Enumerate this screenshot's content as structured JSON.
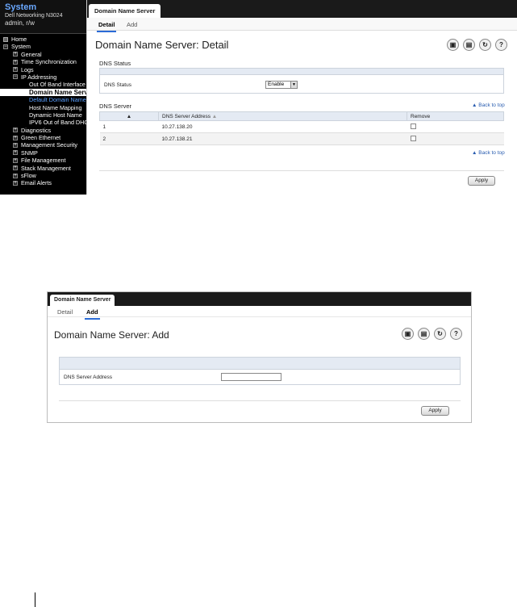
{
  "shot1": {
    "sidebar": {
      "system_title": "System",
      "model": "Dell Networking N3024",
      "user": "admin, r/w",
      "tree": [
        {
          "label": "Home",
          "indent": 0,
          "kind": "plain"
        },
        {
          "label": "System",
          "indent": 0,
          "kind": "collapse"
        },
        {
          "label": "General",
          "indent": 1,
          "kind": "expand"
        },
        {
          "label": "Time Synchronization",
          "indent": 1,
          "kind": "expand"
        },
        {
          "label": "Logs",
          "indent": 1,
          "kind": "expand"
        },
        {
          "label": "IP Addressing",
          "indent": 1,
          "kind": "collapse"
        },
        {
          "label": "Out Of Band Interface",
          "indent": 2,
          "kind": "leaf"
        },
        {
          "label": "Domain Name Server",
          "indent": 2,
          "kind": "selected"
        },
        {
          "label": "Default Domain Name",
          "indent": 2,
          "kind": "sub"
        },
        {
          "label": "Host Name Mapping",
          "indent": 2,
          "kind": "leaf"
        },
        {
          "label": "Dynamic Host Name",
          "indent": 2,
          "kind": "leaf"
        },
        {
          "label": "IPV6 Out of Band DHCP",
          "indent": 2,
          "kind": "leaf"
        },
        {
          "label": "Diagnostics",
          "indent": 1,
          "kind": "expand"
        },
        {
          "label": "Green Ethernet",
          "indent": 1,
          "kind": "expand"
        },
        {
          "label": "Management Security",
          "indent": 1,
          "kind": "expand"
        },
        {
          "label": "SNMP",
          "indent": 1,
          "kind": "expand"
        },
        {
          "label": "File Management",
          "indent": 1,
          "kind": "expand"
        },
        {
          "label": "Stack Management",
          "indent": 1,
          "kind": "expand"
        },
        {
          "label": "sFlow",
          "indent": 1,
          "kind": "expand"
        },
        {
          "label": "Email Alerts",
          "indent": 1,
          "kind": "expand"
        }
      ]
    },
    "tab": "Domain Name Server",
    "subtabs": {
      "detail": "Detail",
      "add": "Add"
    },
    "title": "Domain Name Server: Detail",
    "icons": [
      "save-icon",
      "print-icon",
      "refresh-icon",
      "help-icon"
    ],
    "dns_status": {
      "section": "DNS Status",
      "label": "DNS Status",
      "value": "Enable"
    },
    "dns_server": {
      "section": "DNS Server",
      "back_to_top": "Back to top",
      "columns": [
        "",
        "DNS Server Address",
        "Remove"
      ],
      "rows": [
        {
          "index": "1",
          "address": "10.27.138.20"
        },
        {
          "index": "2",
          "address": "10.27.138.21"
        }
      ]
    },
    "apply": "Apply"
  },
  "shot2": {
    "tab": "Domain Name Server",
    "subtabs": {
      "detail": "Detail",
      "add": "Add"
    },
    "title": "Domain Name Server: Add",
    "icons": [
      "save-icon",
      "print-icon",
      "refresh-icon",
      "help-icon"
    ],
    "field_label": "DNS Server Address",
    "field_value": "",
    "apply": "Apply"
  }
}
